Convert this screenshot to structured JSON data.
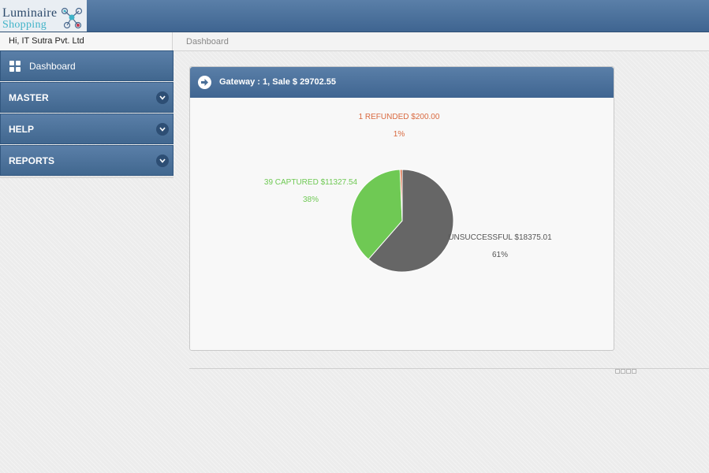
{
  "brand": {
    "line1": "Luminaire",
    "line2": "Shopping",
    "icon": "network-molecule-icon"
  },
  "user": {
    "greeting": "Hi, IT Sutra Pvt. Ltd"
  },
  "breadcrumb": {
    "current": "Dashboard"
  },
  "sidebar": {
    "items": [
      {
        "label": "Dashboard",
        "icon": "grid-icon"
      },
      {
        "label": "MASTER",
        "icon": "chevron-down-icon"
      },
      {
        "label": "HELP",
        "icon": "chevron-down-icon"
      },
      {
        "label": "REPORTS",
        "icon": "chevron-down-icon"
      }
    ]
  },
  "panel": {
    "title": "Gateway : 1, Sale $ 29702.55",
    "icon": "arrow-right-circle-icon"
  },
  "colors": {
    "header": "#4a6f98",
    "unsuccessful": "#666666",
    "captured": "#6fc954",
    "refunded": "#d9693f"
  },
  "chart_data": {
    "type": "pie",
    "slices": [
      {
        "name": "UNSUCCESSFUL",
        "count": null,
        "amount": 18375.01,
        "label": "UNSUCCESSFUL $18375.01",
        "percent_label": "61%",
        "value": 18375.01,
        "color": "#666666"
      },
      {
        "name": "CAPTURED",
        "count": 39,
        "amount": 11327.54,
        "label": "39 CAPTURED $11327.54",
        "percent_label": "38%",
        "value": 11327.54,
        "color": "#6fc954"
      },
      {
        "name": "REFUNDED",
        "count": 1,
        "amount": 200.0,
        "label": "1 REFUNDED $200.00",
        "percent_label": "1%",
        "value": 200.0,
        "color": "#d9693f"
      }
    ]
  }
}
